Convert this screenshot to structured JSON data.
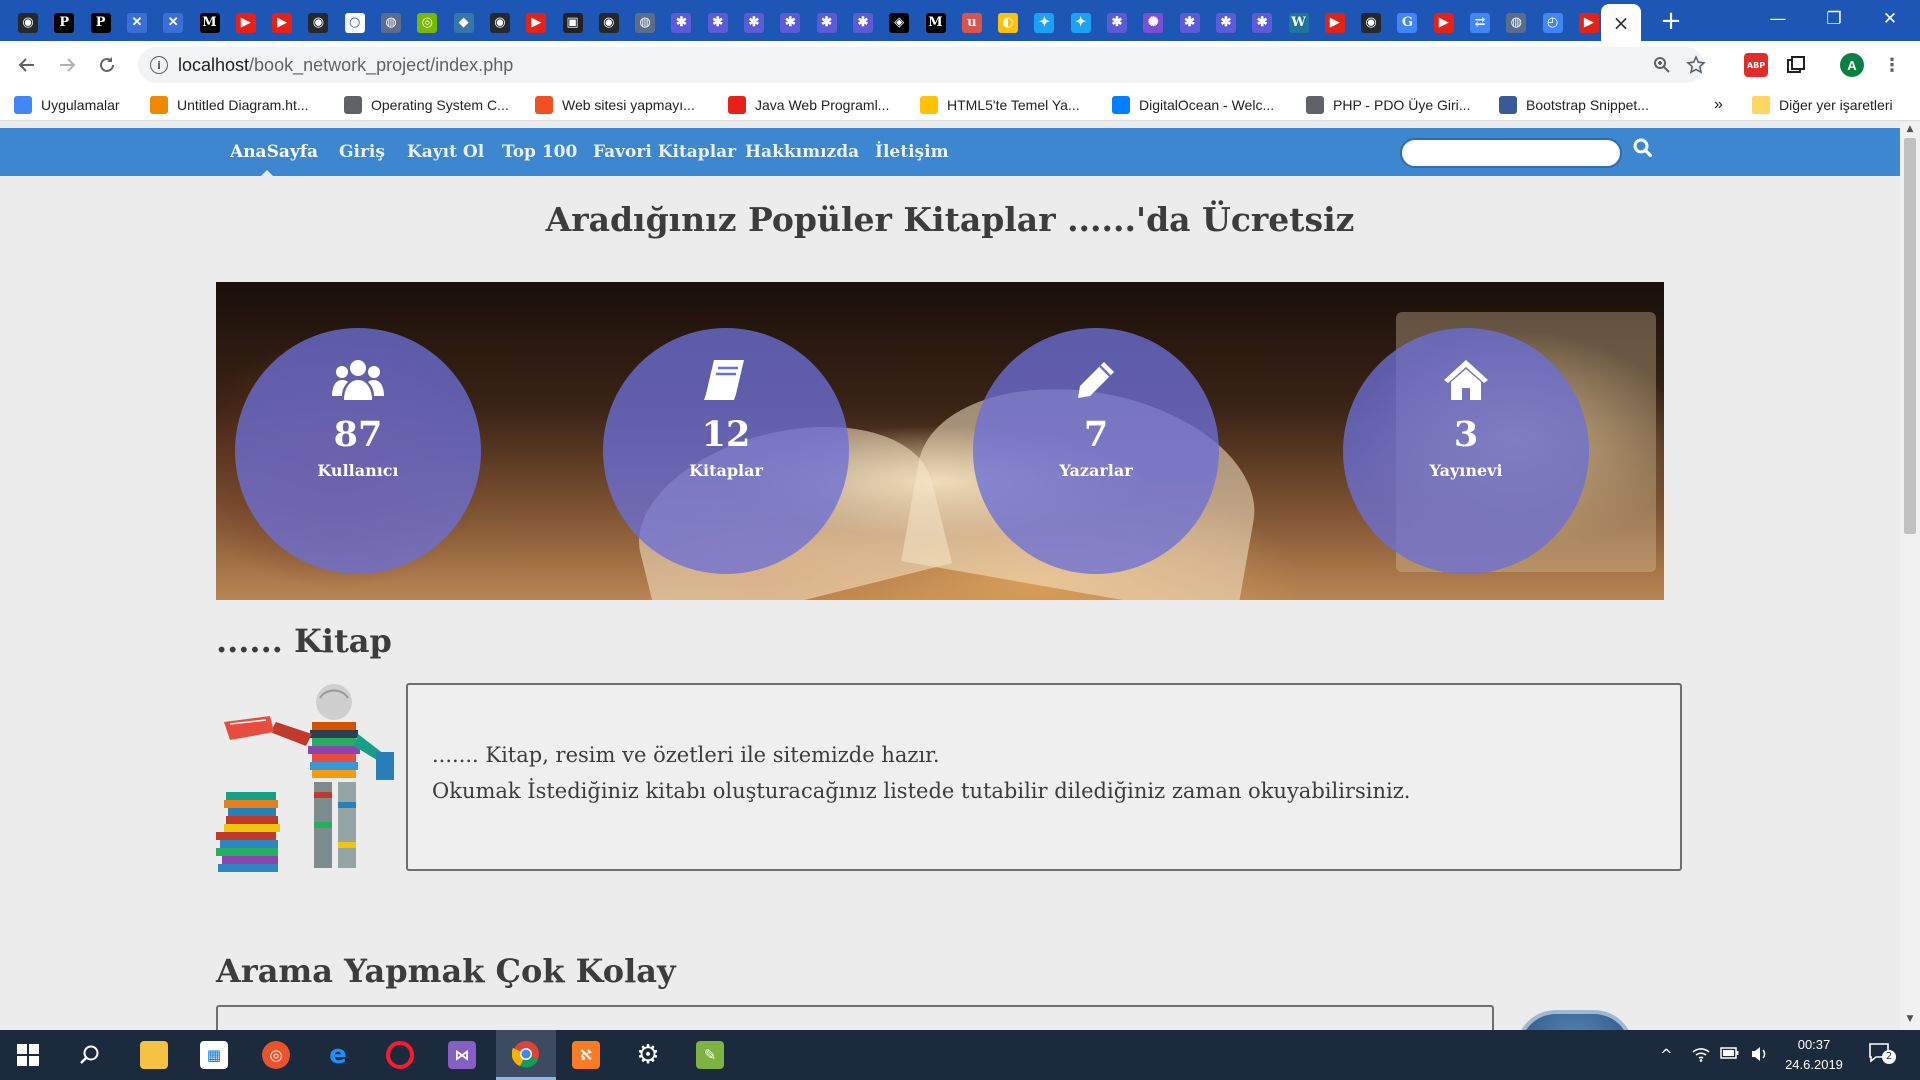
{
  "browser": {
    "tabs": [
      {
        "icon": "github-icon",
        "color": "#24292e",
        "glyph": "◉"
      },
      {
        "icon": "p-icon",
        "color": "#000000",
        "glyph": "P"
      },
      {
        "icon": "p-icon",
        "color": "#000000",
        "glyph": "P"
      },
      {
        "icon": "x-icon",
        "color": "#3b6fd6",
        "glyph": "✕"
      },
      {
        "icon": "x-icon",
        "color": "#3b6fd6",
        "glyph": "✕"
      },
      {
        "icon": "medium-icon",
        "color": "#000000",
        "glyph": "M"
      },
      {
        "icon": "youtube-icon",
        "color": "#e62117",
        "glyph": "▶"
      },
      {
        "icon": "youtube-icon",
        "color": "#e62117",
        "glyph": "▶"
      },
      {
        "icon": "github-icon",
        "color": "#24292e",
        "glyph": "◉"
      },
      {
        "icon": "circle-icon",
        "color": "#ffffff",
        "glyph": "○"
      },
      {
        "icon": "globe-icon",
        "color": "#5a6d8a",
        "glyph": "◍"
      },
      {
        "icon": "nvidia-icon",
        "color": "#76b900",
        "glyph": "◎"
      },
      {
        "icon": "python-icon",
        "color": "#3776ab",
        "glyph": "◆"
      },
      {
        "icon": "github-icon",
        "color": "#24292e",
        "glyph": "◉"
      },
      {
        "icon": "youtube-icon",
        "color": "#e62117",
        "glyph": "▶"
      },
      {
        "icon": "video-icon",
        "color": "#222222",
        "glyph": "▣"
      },
      {
        "icon": "github-icon",
        "color": "#24292e",
        "glyph": "◉"
      },
      {
        "icon": "globe-icon",
        "color": "#5a6d8a",
        "glyph": "◍"
      },
      {
        "icon": "gear-icon",
        "color": "#5b5bd6",
        "glyph": "✱"
      },
      {
        "icon": "gear-icon",
        "color": "#5b5bd6",
        "glyph": "✱"
      },
      {
        "icon": "gear-icon",
        "color": "#5b5bd6",
        "glyph": "✱"
      },
      {
        "icon": "gear-icon",
        "color": "#5b5bd6",
        "glyph": "✱"
      },
      {
        "icon": "gear-icon",
        "color": "#5b5bd6",
        "glyph": "✱"
      },
      {
        "icon": "gear-icon",
        "color": "#5b5bd6",
        "glyph": "✱"
      },
      {
        "icon": "codepen-icon",
        "color": "#000000",
        "glyph": "◈"
      },
      {
        "icon": "medium-icon",
        "color": "#000000",
        "glyph": "M"
      },
      {
        "icon": "u-icon",
        "color": "#d9534f",
        "glyph": "u"
      },
      {
        "icon": "turkcell-icon",
        "color": "#ffc107",
        "glyph": "◐"
      },
      {
        "icon": "twitter-icon",
        "color": "#1da1f2",
        "glyph": "✦"
      },
      {
        "icon": "twitter-icon",
        "color": "#1da1f2",
        "glyph": "✦"
      },
      {
        "icon": "gear-icon",
        "color": "#5b5bd6",
        "glyph": "✱"
      },
      {
        "icon": "hub-icon",
        "color": "#7a4fd6",
        "glyph": "✺"
      },
      {
        "icon": "gear-icon",
        "color": "#5b5bd6",
        "glyph": "✱"
      },
      {
        "icon": "gear-icon",
        "color": "#5b5bd6",
        "glyph": "✱"
      },
      {
        "icon": "gear-icon",
        "color": "#5b5bd6",
        "glyph": "✱"
      },
      {
        "icon": "wordpress-icon",
        "color": "#21759b",
        "glyph": "W"
      },
      {
        "icon": "youtube-icon",
        "color": "#e62117",
        "glyph": "▶"
      },
      {
        "icon": "github-icon",
        "color": "#24292e",
        "glyph": "◉"
      },
      {
        "icon": "google-icon",
        "color": "#4285f4",
        "glyph": "G"
      },
      {
        "icon": "youtube-icon",
        "color": "#e62117",
        "glyph": "▶"
      },
      {
        "icon": "translate-icon",
        "color": "#4285f4",
        "glyph": "⇄"
      },
      {
        "icon": "globe-icon",
        "color": "#5a6d8a",
        "glyph": "◍"
      },
      {
        "icon": "clock-icon",
        "color": "#4285f4",
        "glyph": "◴"
      },
      {
        "icon": "youtube-icon",
        "color": "#e62117",
        "glyph": "▶"
      }
    ],
    "active_tab_close": "×",
    "new_tab": "+",
    "window_controls": {
      "minimize": "—",
      "restore": "❐",
      "close": "✕"
    }
  },
  "toolbar": {
    "url_host": "localhost",
    "url_path": "/book_network_project/index.php",
    "avatar_letter": "A",
    "abp_label": "ABP"
  },
  "bookmarks": [
    {
      "label": "Uygulamalar",
      "icon": "apps-icon",
      "color": "#4285f4"
    },
    {
      "label": "Untitled Diagram.ht...",
      "icon": "drawio-icon",
      "color": "#f08705"
    },
    {
      "label": "Operating System C...",
      "icon": "globe-icon",
      "color": "#5f6368"
    },
    {
      "label": "Web sitesi yapmayı...",
      "icon": "microsoft-icon",
      "color": "#f25022"
    },
    {
      "label": "Java Web Programl...",
      "icon": "youtube-icon",
      "color": "#e62117"
    },
    {
      "label": "HTML5'te Temel Ya...",
      "icon": "turkcell-icon",
      "color": "#ffc107"
    },
    {
      "label": "DigitalOcean - Welc...",
      "icon": "digitalocean-icon",
      "color": "#0080ff"
    },
    {
      "label": "PHP - PDO Üye Giri...",
      "icon": "globe-icon",
      "color": "#5f6368"
    },
    {
      "label": "Bootstrap Snippet...",
      "icon": "bootstrap-icon",
      "color": "#3b5998"
    }
  ],
  "bookmarks_more": "»",
  "bookmarks_other": "Diğer yer işaretleri",
  "site": {
    "nav": [
      {
        "label": "AnaSayfa",
        "active": true
      },
      {
        "label": "Giriş"
      },
      {
        "label": "Kayıt Ol"
      },
      {
        "label": "Top 100"
      },
      {
        "label": "Favori Kitaplar"
      },
      {
        "label": "Hakkımızda"
      },
      {
        "label": "İletişim"
      }
    ],
    "search_placeholder": "",
    "headline": "Aradığınız Popüler Kitaplar ......'da Ücretsiz",
    "stats": [
      {
        "value": "87",
        "label": "Kullanıcı",
        "icon": "users-icon"
      },
      {
        "value": "12",
        "label": "Kitaplar",
        "icon": "book-icon"
      },
      {
        "value": "7",
        "label": "Yazarlar",
        "icon": "pencil-icon"
      },
      {
        "value": "3",
        "label": "Yayınevi",
        "icon": "home-icon"
      }
    ],
    "section1_title": "...... Kitap",
    "section1_line1": "....... Kitap, resim ve özetleri ile sitemizde hazır.",
    "section1_line2": "Okumak İstediğiniz kitabı oluşturacağınız listede tutabilir dilediğiniz zaman okuyabilirsiniz.",
    "section2_title": "Arama Yapmak Çok Kolay"
  },
  "taskbar": {
    "time": "00:37",
    "date": "24.6.2019",
    "notification_count": "2"
  }
}
